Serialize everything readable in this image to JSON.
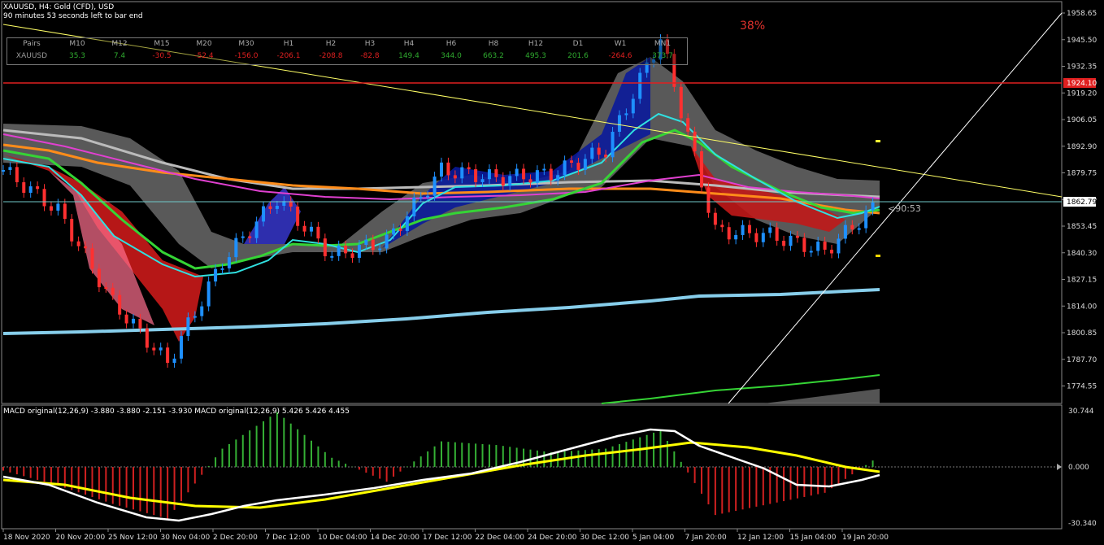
{
  "header": {
    "line1": "XAUUSD, H4:  Gold (CFD), USD",
    "line2": "90 minutes 53 seconds left to bar end"
  },
  "percent_label": "38%",
  "countdown": "<90:53",
  "strength_table": {
    "headers": [
      "Pairs",
      "M10",
      "M12",
      "M15",
      "M20",
      "M30",
      "H1",
      "H2",
      "H3",
      "H4",
      "H6",
      "H8",
      "H12",
      "D1",
      "W1",
      "MN1"
    ],
    "row": [
      "XAUUSD",
      "35.3",
      "7.4",
      "-30.5",
      "-52.4",
      "-156.0",
      "-206.1",
      "-208.8",
      "-82.8",
      "149.4",
      "344.0",
      "663.2",
      "495.3",
      "201.6",
      "-264.6",
      "373.7"
    ]
  },
  "colors": {
    "background": "#000000",
    "bull_candle": "#1e90ff",
    "bear_candle": "#ff3030",
    "price_line": "#87ceeb",
    "resistance": "#e02020",
    "trend": "#ffff66",
    "macd_signal": "#ffff00",
    "macd_main": "#ffffff"
  },
  "price_axis": {
    "ticks": [
      "1958.65",
      "1945.50",
      "1932.35",
      "1919.20",
      "1906.05",
      "1892.90",
      "1879.75",
      "1866.60",
      "1853.45",
      "1840.30",
      "1827.15",
      "1814.00",
      "1800.85",
      "1787.70",
      "1774.55"
    ],
    "current_price": "1862.79",
    "resistance_price": "1924.10"
  },
  "macd": {
    "title": "MACD original(12,26,9) -3.880 -3.880 -2.151 -3.930 MACD original(12,26,9) 5.426 5.426 4.455",
    "ticks": [
      "30.744",
      "0.000",
      "-30.340"
    ]
  },
  "time_axis": {
    "labels": [
      "18 Nov 2020",
      "20 Nov 20:00",
      "25 Nov 12:00",
      "30 Nov 04:00",
      "2 Dec 20:00",
      "7 Dec 12:00",
      "10 Dec 04:00",
      "14 Dec 20:00",
      "17 Dec 12:00",
      "22 Dec 04:00",
      "24 Dec 20:00",
      "30 Dec 12:00",
      "5 Jan 04:00",
      "7 Jan 20:00",
      "12 Jan 12:00",
      "15 Jan 04:00",
      "19 Jan 20:00"
    ]
  },
  "chart_data": {
    "type": "line",
    "title": "XAUUSD, H4",
    "xlabel": "",
    "ylabel": "",
    "ylim": [
      1766,
      1962
    ],
    "x": [
      "18 Nov 2020",
      "20 Nov 20:00",
      "25 Nov 12:00",
      "30 Nov 04:00",
      "2 Dec 20:00",
      "7 Dec 12:00",
      "10 Dec 04:00",
      "14 Dec 20:00",
      "17 Dec 12:00",
      "22 Dec 04:00",
      "24 Dec 20:00",
      "30 Dec 12:00",
      "5 Jan 04:00",
      "7 Jan 20:00",
      "12 Jan 12:00",
      "15 Jan 04:00",
      "19 Jan 20:00"
    ],
    "series": [
      {
        "values": [
          1880,
          1860,
          1815,
          1785,
          1835,
          1866,
          1838,
          1845,
          1880,
          1876,
          1878,
          1890,
          1945,
          1850,
          1848,
          1840,
          1864
        ]
      }
    ],
    "macd_series": [
      {
        "values": [
          -2,
          -10,
          -20,
          -28,
          10,
          30,
          5,
          -8,
          14,
          12,
          8,
          10,
          20,
          -26,
          -20,
          -14,
          6
        ]
      }
    ],
    "macd_ylim": [
      -30.34,
      30.744
    ]
  }
}
